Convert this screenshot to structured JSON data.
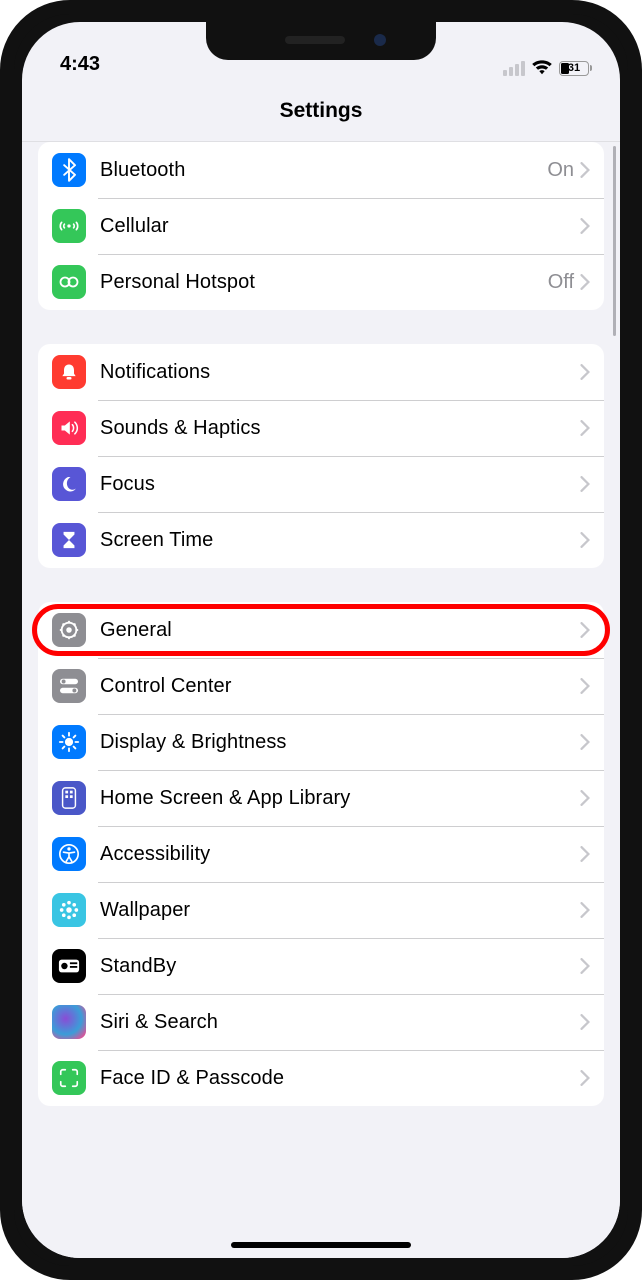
{
  "status": {
    "time": "4:43",
    "battery": "31"
  },
  "header": {
    "title": "Settings"
  },
  "groups": [
    {
      "rows": [
        {
          "icon": "bluetooth",
          "bg": "#007aff",
          "label": "Bluetooth",
          "value": "On"
        },
        {
          "icon": "cellular",
          "bg": "#34c759",
          "label": "Cellular",
          "value": ""
        },
        {
          "icon": "hotspot",
          "bg": "#34c759",
          "label": "Personal Hotspot",
          "value": "Off"
        }
      ]
    },
    {
      "rows": [
        {
          "icon": "bell",
          "bg": "#ff3b30",
          "label": "Notifications",
          "value": ""
        },
        {
          "icon": "speaker",
          "bg": "#ff2d55",
          "label": "Sounds & Haptics",
          "value": ""
        },
        {
          "icon": "moon",
          "bg": "#5856d6",
          "label": "Focus",
          "value": ""
        },
        {
          "icon": "hourglass",
          "bg": "#5856d6",
          "label": "Screen Time",
          "value": ""
        }
      ]
    },
    {
      "rows": [
        {
          "icon": "gear",
          "bg": "#8e8e93",
          "label": "General",
          "value": "",
          "highlight": true
        },
        {
          "icon": "switches",
          "bg": "#8e8e93",
          "label": "Control Center",
          "value": ""
        },
        {
          "icon": "brightness",
          "bg": "#007aff",
          "label": "Display & Brightness",
          "value": ""
        },
        {
          "icon": "homescreen",
          "bg": "#4a57c8",
          "label": "Home Screen & App Library",
          "value": ""
        },
        {
          "icon": "accessibility",
          "bg": "#007aff",
          "label": "Accessibility",
          "value": ""
        },
        {
          "icon": "wallpaper",
          "bg": "#39c5e3",
          "label": "Wallpaper",
          "value": ""
        },
        {
          "icon": "standby",
          "bg": "#000000",
          "label": "StandBy",
          "value": ""
        },
        {
          "icon": "siri",
          "bg": "#1c1c1e",
          "label": "Siri & Search",
          "value": ""
        },
        {
          "icon": "faceid",
          "bg": "#34c759",
          "label": "Face ID & Passcode",
          "value": ""
        }
      ]
    }
  ]
}
